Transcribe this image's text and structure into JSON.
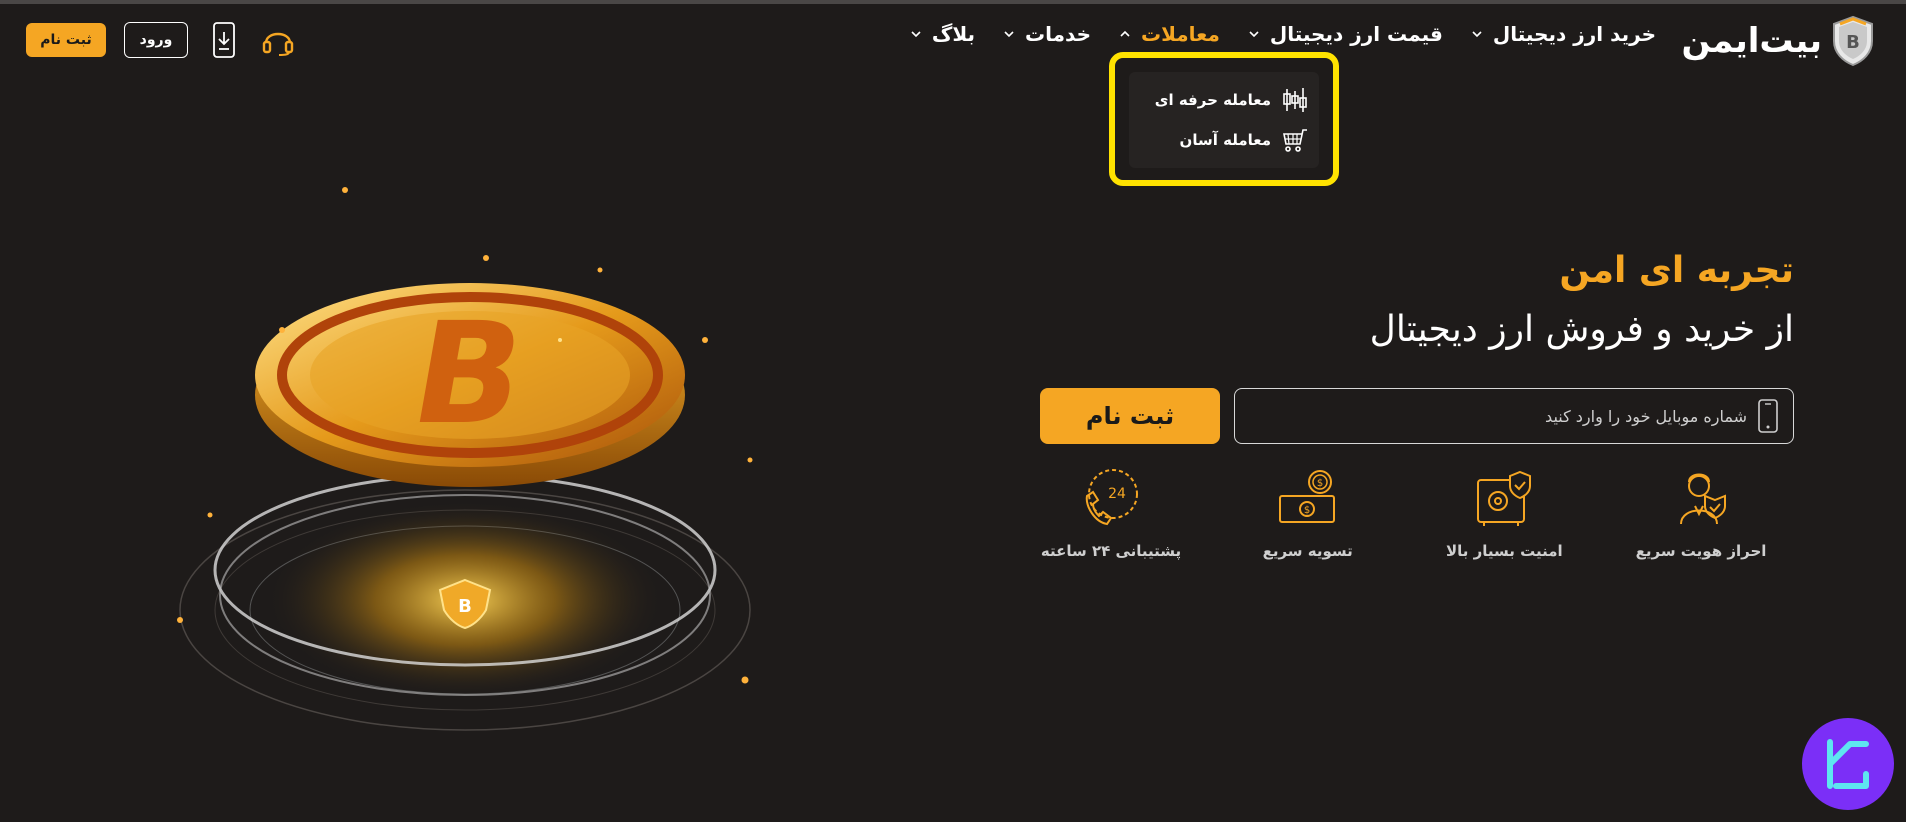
{
  "header": {
    "logo_text": "بیت‌ایمن",
    "nav": [
      {
        "label": "خرید ارز دیجیتال",
        "active": false
      },
      {
        "label": "قیمت ارز دیجیتال",
        "active": false
      },
      {
        "label": "معاملات",
        "active": true
      },
      {
        "label": "خدمات",
        "active": false
      },
      {
        "label": "بلاگ",
        "active": false
      }
    ],
    "signup_label": "ثبت نام",
    "login_label": "ورود",
    "icons": [
      "headset-icon",
      "mobile-download-icon"
    ]
  },
  "dropdown": {
    "items": [
      {
        "label": "معامله حرفه ای",
        "icon": "candlestick-icon"
      },
      {
        "label": "معامله آسان",
        "icon": "cart-icon"
      }
    ]
  },
  "hero": {
    "title": "تجربه ای امن",
    "subtitle": "از خرید و فروش ارز دیجیتال",
    "phone_placeholder": "شماره موبایل خود را وارد کنید",
    "phone_value": "",
    "signup_label": "ثبت نام"
  },
  "features": [
    {
      "label": "احراز هویت سریع",
      "icon": "agent-verify-icon"
    },
    {
      "label": "امنیت بسیار بالا",
      "icon": "safe-shield-icon"
    },
    {
      "label": "تسویه سریع",
      "icon": "cash-coin-icon"
    },
    {
      "label": "پشتیبانی ۲۴ ساعته",
      "icon": "phone-24-icon"
    }
  ],
  "colors": {
    "background": "#1e1b1a",
    "accent": "#f5a623",
    "highlight": "#ffe200",
    "watermark": "#7b2ff7"
  }
}
